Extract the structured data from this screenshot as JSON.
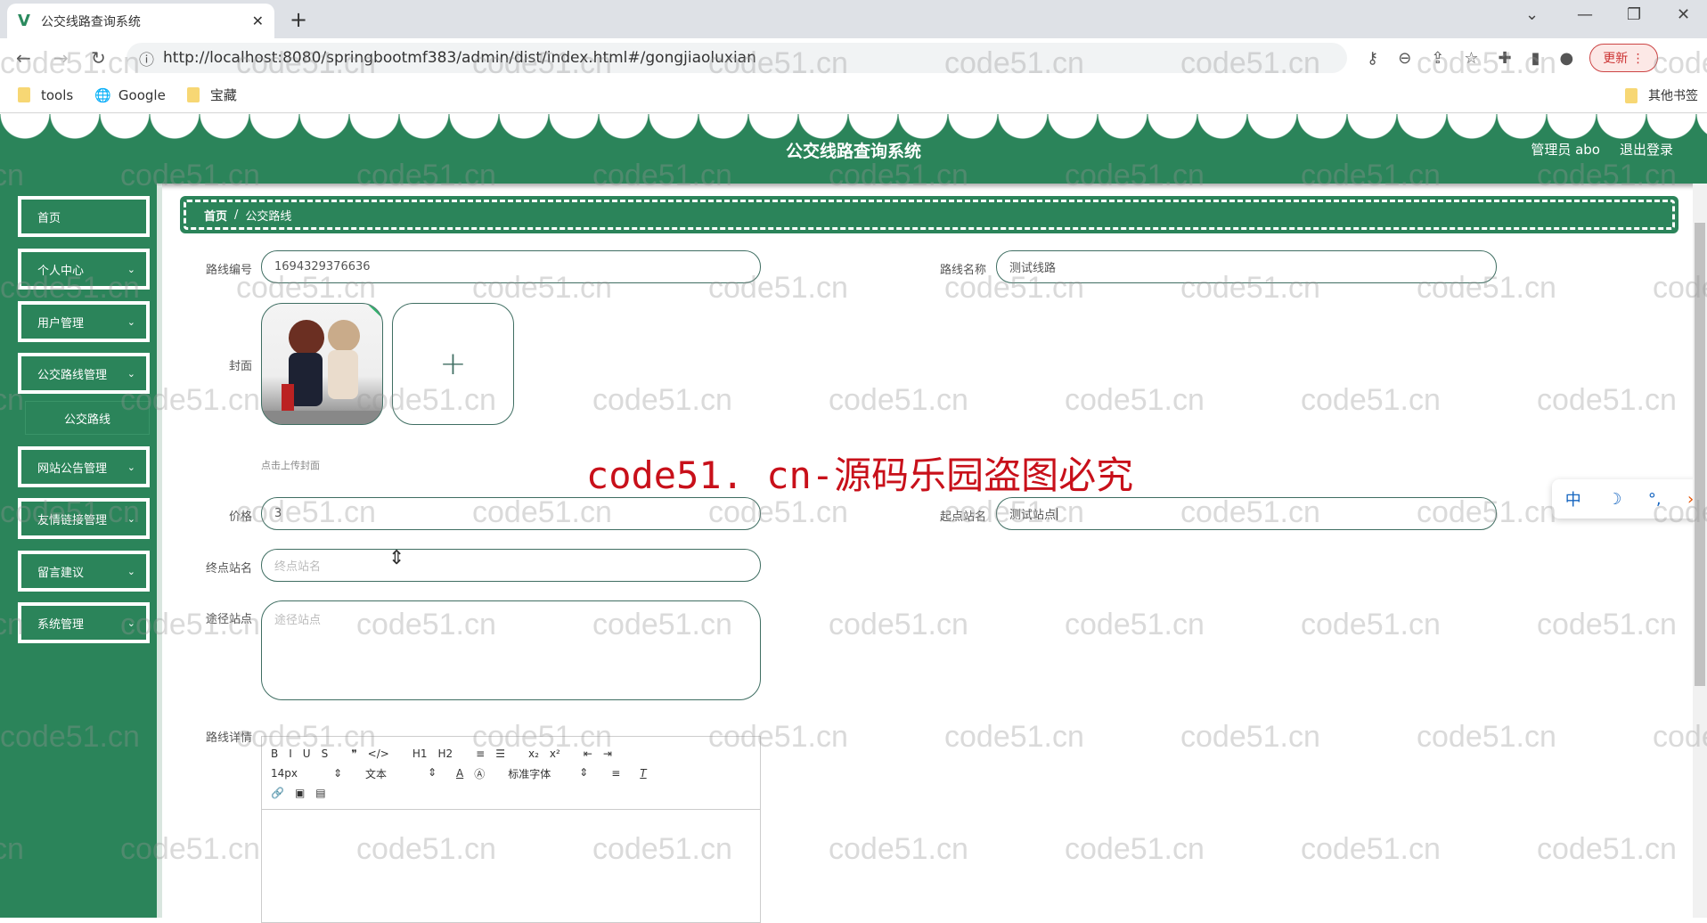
{
  "browser": {
    "tab_title": "公交线路查询系统",
    "url": "http://localhost:8080/springbootmf383/admin/dist/index.html#/gongjiaoluxian",
    "update_label": "更新",
    "bookmarks": [
      {
        "label": "tools",
        "icon": "folder-icon"
      },
      {
        "label": "Google",
        "icon": "globe-icon"
      },
      {
        "label": "宝藏",
        "icon": "folder-icon"
      }
    ],
    "other_bookmarks": "其他书签"
  },
  "header": {
    "title": "公交线路查询系统",
    "user": "管理员 abo",
    "logout": "退出登录",
    "color": "#2b845a"
  },
  "sidebar": {
    "items": [
      {
        "label": "首页",
        "chevron": false
      },
      {
        "label": "个人中心",
        "chevron": true
      },
      {
        "label": "用户管理",
        "chevron": true
      },
      {
        "label": "公交路线管理",
        "chevron": true
      },
      {
        "label": "网站公告管理",
        "chevron": true
      },
      {
        "label": "友情链接管理",
        "chevron": true
      },
      {
        "label": "留言建议",
        "chevron": true
      },
      {
        "label": "系统管理",
        "chevron": true
      }
    ],
    "sub_item": "公交路线"
  },
  "breadcrumb": {
    "home": "首页",
    "separator": "/",
    "current": "公交路线"
  },
  "form": {
    "route_no": {
      "label": "路线编号",
      "value": "1694329376636"
    },
    "route_name": {
      "label": "路线名称",
      "value": "测试线路"
    },
    "cover": {
      "label": "封面",
      "hint": "点击上传封面",
      "add": "+"
    },
    "price": {
      "label": "价格",
      "value": "3"
    },
    "start": {
      "label": "起点站名",
      "value": "测试站点"
    },
    "end": {
      "label": "终点站名",
      "placeholder": "终点站名"
    },
    "via": {
      "label": "途径站点",
      "placeholder": "途径站点"
    },
    "detail": {
      "label": "路线详情"
    }
  },
  "editor": {
    "row1": [
      "B",
      "I",
      "U",
      "S",
      "❞",
      "</>",
      "H1",
      "H2",
      "≡",
      "☰",
      "x₂",
      "x²",
      "⇤",
      "⇥"
    ],
    "font_size": "14px",
    "header_sel": "文本",
    "font_family": "标准字体",
    "row3": [
      "🔗",
      "▣",
      "▤"
    ]
  },
  "watermark": {
    "text": "code51.cn",
    "red": "code51. cn-源码乐园盗图必究"
  },
  "ime": {
    "items": [
      "中",
      "☽",
      "°,",
      "›"
    ]
  }
}
